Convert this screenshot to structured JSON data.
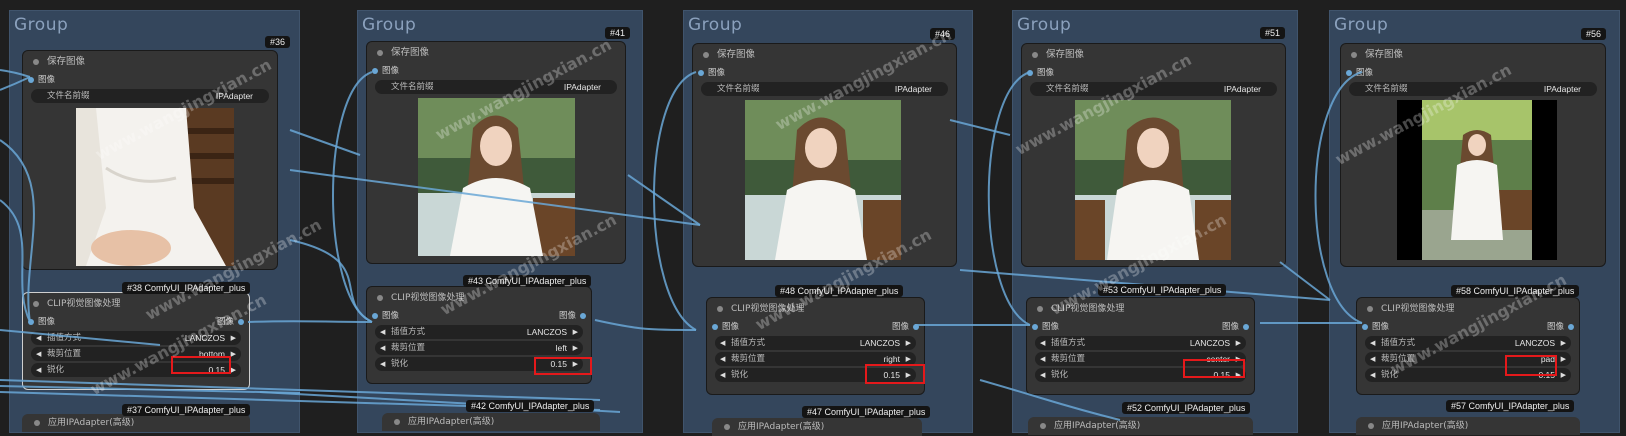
{
  "group_title": "Group",
  "save_node": {
    "title": "保存图像",
    "input_label": "图像",
    "prefix_label": "文件名前缀",
    "prefix_value": "IPAdapter"
  },
  "clip_node": {
    "title": "CLIP视觉图像处理",
    "input_label": "图像",
    "output_label": "图像",
    "interp_label": "插值方式",
    "interp_value": "LANCZOS",
    "crop_label": "裁剪位置",
    "sharp_label": "锐化",
    "sharp_value": "0.15"
  },
  "apply_node_title": "应用IPAdapter(高级)",
  "columns": [
    {
      "save_id": "#36",
      "clip_badge": "#38 ComfyUI_IPAdapter_plus",
      "crop_value": "bottom",
      "apply_badge": "#37 ComfyUI_IPAdapter_plus"
    },
    {
      "save_id": "#41",
      "clip_badge": "#43 ComfyUI_IPAdapter_plus",
      "crop_value": "left",
      "apply_badge": "#42 ComfyUI_IPAdapter_plus"
    },
    {
      "save_id": "#46",
      "clip_badge": "#48 ComfyUI_IPAdapter_plus",
      "crop_value": "right",
      "apply_badge": "#47 ComfyUI_IPAdapter_plus"
    },
    {
      "save_id": "#51",
      "clip_badge": "#53 ComfyUI_IPAdapter_plus",
      "crop_value": "center",
      "apply_badge": "#52 ComfyUI_IPAdapter_plus"
    },
    {
      "save_id": "#56",
      "clip_badge": "#58 ComfyUI_IPAdapter_plus",
      "crop_value": "pad",
      "apply_badge": "#57 ComfyUI_IPAdapter_plus"
    }
  ],
  "watermark": "www.wangjingxian.cn",
  "colors": {
    "canvas": "#1f1f1f",
    "group": "#34465c",
    "node": "#353535",
    "wire": "#6aa7d6",
    "highlight": "#e5191b"
  }
}
